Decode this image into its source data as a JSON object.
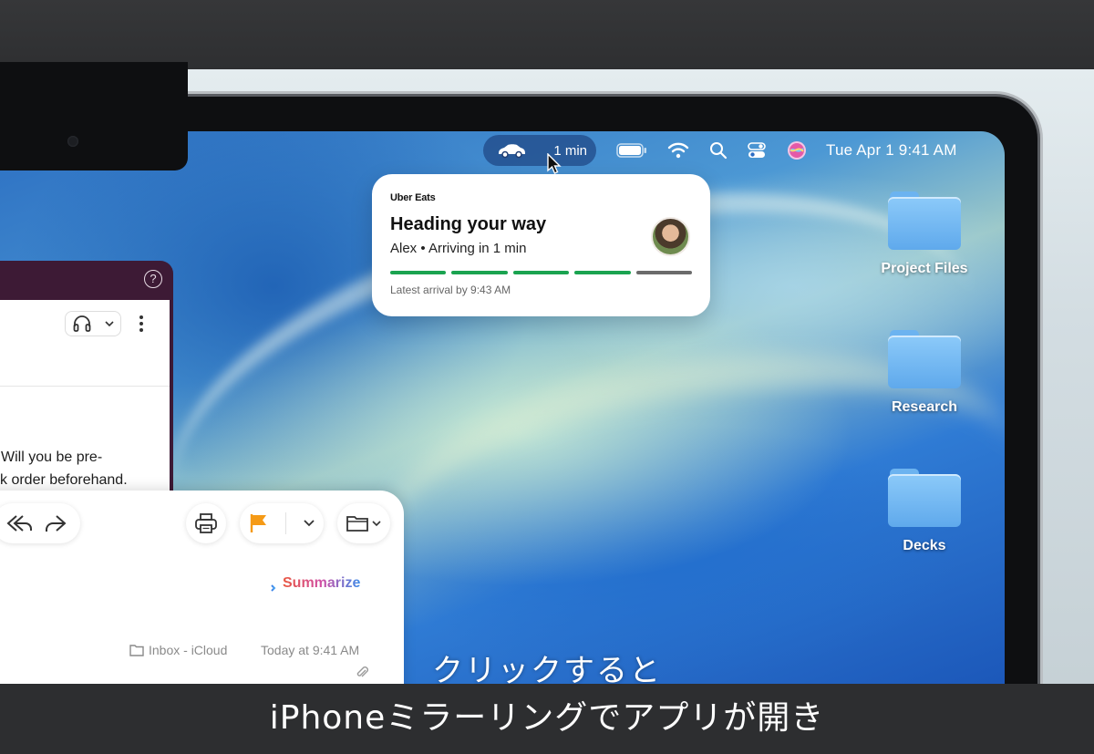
{
  "menu_bar": {
    "uber_pill_text": "1 min",
    "clock": "Tue Apr 1  9:41 AM"
  },
  "notification": {
    "brand": "Uber Eats",
    "heading": "Heading your way",
    "subtitle": "Alex • Arriving in 1 min",
    "latest_arrival": "Latest arrival by 9:43 AM",
    "progress_segments": [
      "done",
      "done",
      "done",
      "done",
      "pending"
    ],
    "colors": {
      "done": "#1aa350",
      "pending": "#6b6b6b"
    }
  },
  "desktop": {
    "items": [
      {
        "label": "Project Files"
      },
      {
        "label": "Research"
      },
      {
        "label": "Decks"
      }
    ]
  },
  "chat_window": {
    "message_line1": "Will you be pre-",
    "message_line2": "k order beforehand."
  },
  "mail": {
    "summarize_label": "Summarize",
    "mailbox": "Inbox - iCloud",
    "date": "Today at 9:41 AM",
    "flag_color": "#f59a16"
  },
  "subtitles": {
    "line1": "クリックすると",
    "line2": "iPhoneミラーリングでアプリが開き"
  }
}
